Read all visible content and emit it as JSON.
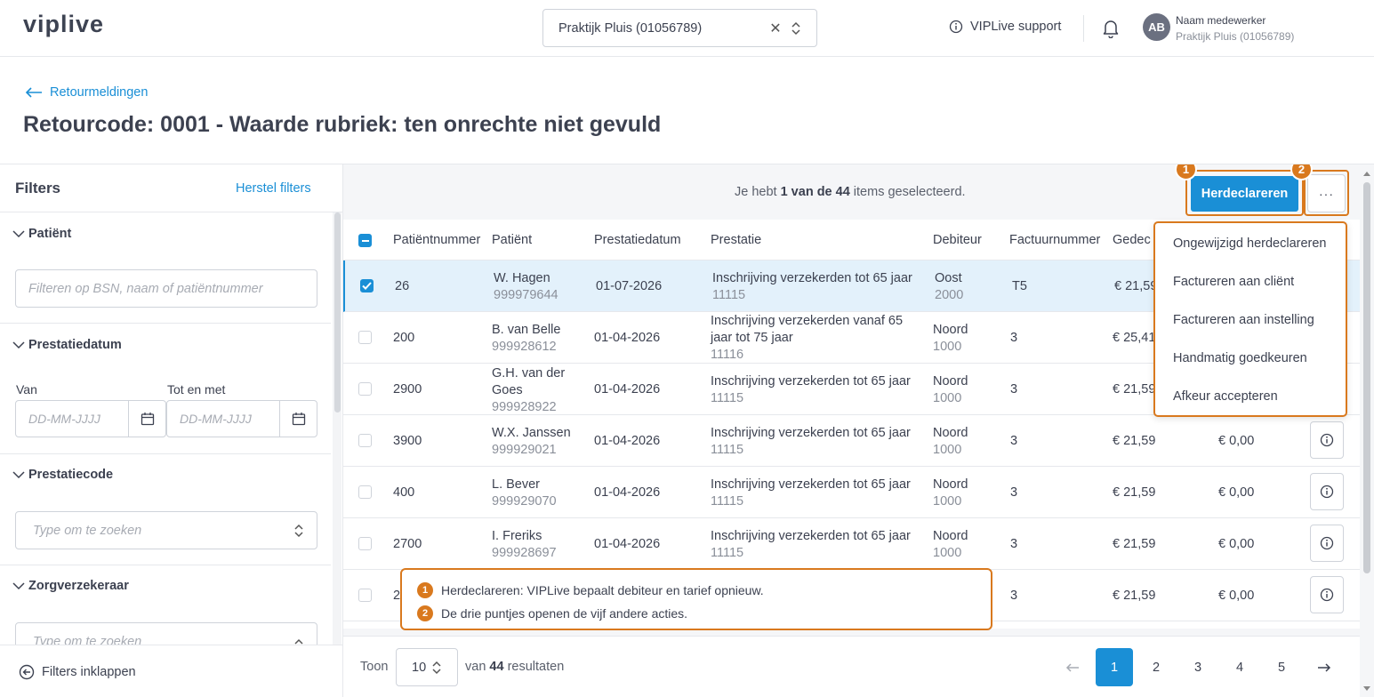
{
  "header": {
    "logo": "viplive",
    "practice_select": "Praktijk Pluis (01056789)",
    "support_label": "VIPLive support",
    "avatar_initials": "AB",
    "user_name": "Naam medewerker",
    "user_practice": "Praktijk Pluis (01056789)"
  },
  "page": {
    "back_label": "Retourmeldingen",
    "title": "Retourcode: 0001 - Waarde rubriek: ten onrechte niet gevuld"
  },
  "filters": {
    "title": "Filters",
    "reset_label": "Herstel filters",
    "patient_title": "Patiënt",
    "patient_placeholder": "Filteren op BSN, naam of patiëntnummer",
    "date_title": "Prestatiedatum",
    "from_label": "Van",
    "to_label": "Tot en met",
    "date_placeholder": "DD-MM-JJJJ",
    "code_title": "Prestatiecode",
    "code_placeholder": "Type om te zoeken",
    "insurer_title": "Zorgverzekeraar",
    "insurer_placeholder": "Type om te zoeken",
    "collapse_label": "Filters inklappen"
  },
  "toolbar": {
    "sel_prefix": "Je hebt ",
    "sel_bold": "1 van de 44",
    "sel_suffix": " items geselecteerd.",
    "herdeclareren_label": "Herdeclareren",
    "more_label": "···",
    "badge1": "1",
    "badge2": "2"
  },
  "table": {
    "headers": [
      "Patiëntnummer",
      "Patiënt",
      "Prestatiedatum",
      "Prestatie",
      "Debiteur",
      "Factuurnummer",
      "Gedec"
    ],
    "rows": [
      {
        "nr": "26",
        "name": "W. Hagen",
        "bsn": "999979644",
        "date": "01-07-2026",
        "prest": "Inschrijving verzekerden tot 65 jaar",
        "code": "11115",
        "deb": "Oost",
        "debnr": "2000",
        "fact": "T5",
        "amt": "€ 21,59",
        "amt2": ""
      },
      {
        "nr": "200",
        "name": "B. van Belle",
        "bsn": "999928612",
        "date": "01-04-2026",
        "prest": "Inschrijving verzekerden vanaf 65 jaar tot 75 jaar",
        "code": "11116",
        "deb": "Noord",
        "debnr": "1000",
        "fact": "3",
        "amt": "€ 25,41",
        "amt2": ""
      },
      {
        "nr": "2900",
        "name": "G.H. van der Goes",
        "bsn": "999928922",
        "date": "01-04-2026",
        "prest": "Inschrijving verzekerden tot 65 jaar",
        "code": "11115",
        "deb": "Noord",
        "debnr": "1000",
        "fact": "3",
        "amt": "€ 21,59",
        "amt2": ""
      },
      {
        "nr": "3900",
        "name": "W.X. Janssen",
        "bsn": "999929021",
        "date": "01-04-2026",
        "prest": "Inschrijving verzekerden tot 65 jaar",
        "code": "11115",
        "deb": "Noord",
        "debnr": "1000",
        "fact": "3",
        "amt": "€ 21,59",
        "amt2": "€ 0,00"
      },
      {
        "nr": "400",
        "name": "L. Bever",
        "bsn": "999929070",
        "date": "01-04-2026",
        "prest": "Inschrijving verzekerden tot 65 jaar",
        "code": "11115",
        "deb": "Noord",
        "debnr": "1000",
        "fact": "3",
        "amt": "€ 21,59",
        "amt2": "€ 0,00"
      },
      {
        "nr": "2700",
        "name": "I. Freriks",
        "bsn": "999928697",
        "date": "01-04-2026",
        "prest": "Inschrijving verzekerden tot 65 jaar",
        "code": "11115",
        "deb": "Noord",
        "debnr": "1000",
        "fact": "3",
        "amt": "€ 21,59",
        "amt2": "€ 0,00"
      },
      {
        "nr": "2",
        "name": "",
        "bsn": "",
        "date": "",
        "prest": "",
        "code": "",
        "deb": "",
        "debnr": "",
        "fact": "3",
        "amt": "€ 21,59",
        "amt2": "€ 0,00"
      }
    ]
  },
  "dropdown": {
    "items": [
      "Ongewijzigd herdeclareren",
      "Factureren aan cliënt",
      "Factureren aan instelling",
      "Handmatig goedkeuren",
      "Afkeur accepteren"
    ]
  },
  "note": {
    "line1": "Herdeclareren: VIPLive bepaalt debiteur en tarief opnieuw.",
    "line2": "De drie puntjes openen de vijf andere acties."
  },
  "pager": {
    "toon_label": "Toon",
    "per_page": "10",
    "results_prefix": "van ",
    "results_count": "44",
    "results_suffix": " resultaten",
    "pages": [
      "1",
      "2",
      "3",
      "4",
      "5"
    ]
  },
  "colors": {
    "accent": "#1a8fd6",
    "highlight": "#d9791e"
  }
}
